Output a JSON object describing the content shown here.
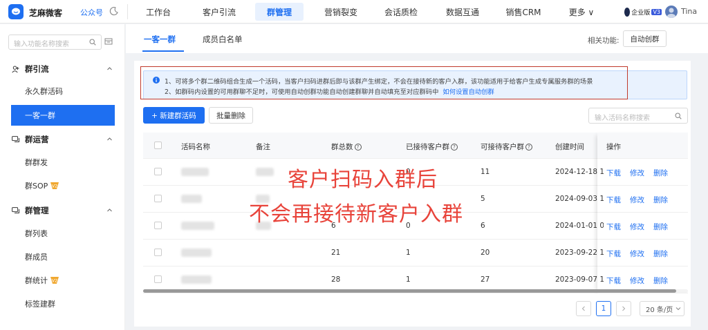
{
  "header": {
    "brand": "芝麻微客",
    "account_type": "公众号",
    "nav": [
      {
        "label": "工作台"
      },
      {
        "label": "客户引流"
      },
      {
        "label": "群管理",
        "active": true
      },
      {
        "label": "营销裂变"
      },
      {
        "label": "会话质检"
      },
      {
        "label": "数据互通"
      },
      {
        "label": "销售CRM"
      },
      {
        "label": "更多 ∨"
      }
    ],
    "enterprise_label": "企业版",
    "enterprise_version": "V3",
    "user_name": "Tina",
    "accent_color": "#1e6ff1"
  },
  "sidebar": {
    "search_placeholder": "输入功能名称搜索",
    "groups": [
      {
        "label": "群引流",
        "icon": "user-plus-icon",
        "items": [
          "永久群活码",
          "一客一群"
        ]
      },
      {
        "label": "群运营",
        "icon": "chat-icon",
        "items": [
          "群群发",
          "群SOP"
        ]
      },
      {
        "label": "群管理",
        "icon": "chat-icon",
        "items": [
          "群列表",
          "群成员",
          "群统计",
          "标签建群"
        ]
      }
    ],
    "active_item": "一客一群"
  },
  "tabs": {
    "items": [
      "一客一群",
      "成员白名单"
    ],
    "related_label": "相关功能:",
    "related_button": "自动创群"
  },
  "notice": {
    "line1": "1、可将多个群二维码组合生成一个活码，当客户扫码进群后即与该群产生绑定，不会在接待新的客户入群，该功能适用于给客户生成专属服务群的场景",
    "line2": "2、如群码内设置的可用群聊不足时，可使用自动创群功能自动创建群聊并自动填充至对应群码中",
    "link": "如何设置自动创群"
  },
  "toolbar": {
    "new_button": "+ 新建群活码",
    "batch_delete": "批量删除",
    "search_placeholder": "输入活码名称搜索"
  },
  "table": {
    "headers": [
      "活码名称",
      "备注",
      "群总数",
      "已接待客户群",
      "可接待客户群",
      "创建时间",
      "操作"
    ],
    "rows": [
      {
        "total": "",
        "received": "0",
        "available": "11",
        "created": "2024-12-18 10"
      },
      {
        "total": "",
        "received": "",
        "available": "5",
        "created": "2024-09-03 10"
      },
      {
        "total": "6",
        "received": "0",
        "available": "6",
        "created": "2024-01-01 00"
      },
      {
        "total": "21",
        "received": "1",
        "available": "20",
        "created": "2023-09-22 12"
      },
      {
        "total": "28",
        "received": "1",
        "available": "27",
        "created": "2023-09-07 16"
      }
    ],
    "actions": [
      "下载",
      "修改",
      "删除"
    ]
  },
  "overlay": {
    "line1": "客户扫码入群后",
    "line2": "不会再接待新客户入群"
  },
  "pagination": {
    "current_page": "1",
    "page_size": "20 条/页"
  }
}
